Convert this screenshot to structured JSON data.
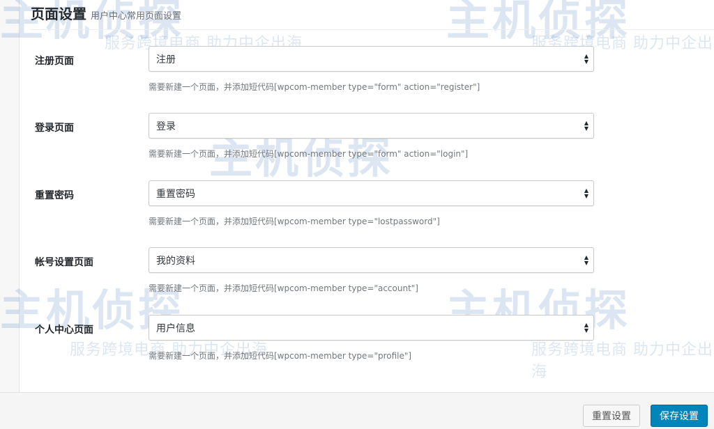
{
  "header": {
    "title": "页面设置",
    "subtitle": "用户中心常用页面设置"
  },
  "rows": [
    {
      "label": "注册页面",
      "selected": "注册",
      "hint": "需要新建一个页面，并添加短代码[wpcom-member type=\"form\" action=\"register\"]"
    },
    {
      "label": "登录页面",
      "selected": "登录",
      "hint": "需要新建一个页面，并添加短代码[wpcom-member type=\"form\" action=\"login\"]"
    },
    {
      "label": "重置密码",
      "selected": "重置密码",
      "hint": "需要新建一个页面，并添加短代码[wpcom-member type=\"lostpassword\"]"
    },
    {
      "label": "帐号设置页面",
      "selected": "我的资料",
      "hint": "需要新建一个页面，并添加短代码[wpcom-member type=\"account\"]"
    },
    {
      "label": "个人中心页面",
      "selected": "用户信息",
      "hint": "需要新建一个页面，并添加短代码[wpcom-member type=\"profile\"]"
    }
  ],
  "footer": {
    "reset_label": "重置设置",
    "save_label": "保存设置"
  },
  "watermark": {
    "logo": "主机侦探",
    "tagline": "服务跨境电商 助力中企出海"
  },
  "colors": {
    "primary_button": "#0085ba",
    "watermark": "#2a6ab0"
  }
}
